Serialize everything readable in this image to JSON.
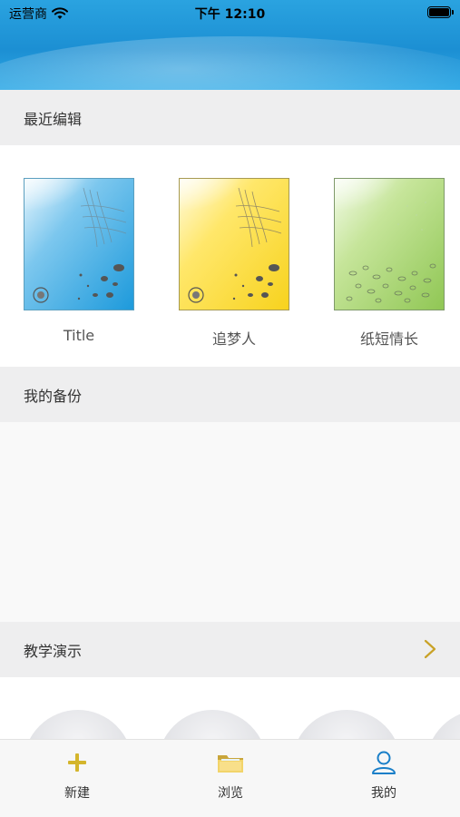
{
  "status_bar": {
    "carrier": "运营商",
    "time": "下午 12:10"
  },
  "sections": {
    "recent": {
      "title": "最近编辑"
    },
    "backup": {
      "title": "我的备份"
    },
    "demo": {
      "title": "教学演示"
    }
  },
  "recent_items": [
    {
      "label": "Title",
      "theme": "blue"
    },
    {
      "label": "追梦人",
      "theme": "yellow"
    },
    {
      "label": "纸短情长",
      "theme": "green"
    }
  ],
  "tabbar": {
    "items": [
      {
        "label": "新建",
        "icon": "plus-icon"
      },
      {
        "label": "浏览",
        "icon": "folder-icon"
      },
      {
        "label": "我的",
        "icon": "person-icon"
      }
    ]
  },
  "colors": {
    "header_blue": "#1c8fd3",
    "section_bg": "#eeeeef",
    "accent_gold": "#c9a227",
    "accent_blue": "#1a7fc8"
  }
}
